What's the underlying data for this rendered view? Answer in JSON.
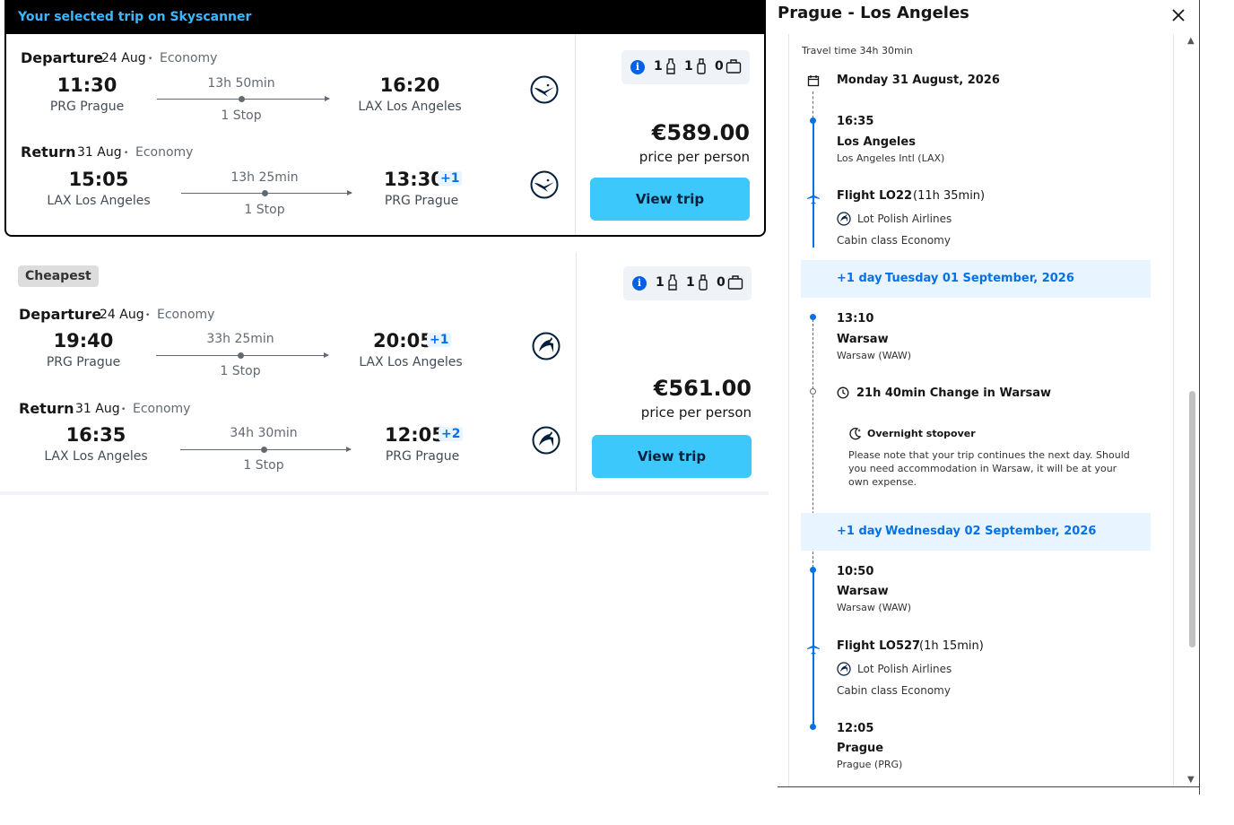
{
  "selected_trip": {
    "header": "Your selected trip on Skyscanner",
    "departure": {
      "title": "Departure",
      "date": "24 Aug",
      "dot": "•",
      "cabin": "Economy",
      "dep_time": "11:30",
      "dep_place": "PRG Prague",
      "duration": "13h 50min",
      "stops": "1 Stop",
      "arr_time": "16:20",
      "arr_place": "LAX Los Angeles",
      "plus_day": ""
    },
    "return": {
      "title": "Return",
      "date": "31 Aug",
      "dot": "•",
      "cabin": "Economy",
      "dep_time": "15:05",
      "dep_place": "LAX Los Angeles",
      "duration": "13h 25min",
      "stops": "1 Stop",
      "arr_time": "13:30",
      "arr_place": "PRG Prague",
      "plus_day": "+1"
    },
    "airline_logo": "lufthansa-crane-icon",
    "bags": {
      "personal": "1",
      "cabin": "1",
      "checked": "0"
    },
    "price": "€589.00",
    "price_sub": "price per person",
    "button": "View trip"
  },
  "cheapest_trip": {
    "badge": "Cheapest",
    "departure": {
      "title": "Departure",
      "date": "24 Aug",
      "dot": "•",
      "cabin": "Economy",
      "dep_time": "19:40",
      "dep_place": "PRG Prague",
      "duration": "33h 25min",
      "stops": "1 Stop",
      "arr_time": "20:05",
      "arr_place": "LAX Los Angeles",
      "plus_day": "+1"
    },
    "return": {
      "title": "Return",
      "date": "31 Aug",
      "dot": "•",
      "cabin": "Economy",
      "dep_time": "16:35",
      "dep_place": "LAX Los Angeles",
      "duration": "34h 30min",
      "stops": "1 Stop",
      "arr_time": "12:05",
      "arr_place": "PRG Prague",
      "plus_day": "+2"
    },
    "airline_logo": "lot-crane-icon",
    "bags": {
      "personal": "1",
      "cabin": "1",
      "checked": "0"
    },
    "price": "€561.00",
    "price_sub": "price per person",
    "button": "View trip"
  },
  "panel": {
    "title": "Prague - Los Angeles",
    "travel_time": "Travel time 34h 30min",
    "date_header": "Monday 31 August, 2026",
    "seg1_time": "16:35",
    "seg1_city": "Los Angeles",
    "seg1_airport": "Los Angeles Intl (LAX)",
    "flight1": "Flight LO22",
    "flight1_duration": "(11h 35min)",
    "flight1_airline": "Lot Polish Airlines",
    "flight1_cabin": "Cabin class Economy",
    "day1_plus": "+1 day",
    "day1_date": "Tuesday 01 September, 2026",
    "seg2_time": "13:10",
    "seg2_city": "Warsaw",
    "seg2_airport": "Warsaw (WAW)",
    "change": "21h 40min Change in Warsaw",
    "stopover_title": "Overnight stopover",
    "stopover_note": "Please note that your trip continues the next day. Should you need accommodation in Warsaw, it will be at your own expense.",
    "day2_plus": "+1 day",
    "day2_date": "Wednesday 02 September, 2026",
    "seg3_time": "10:50",
    "seg3_city": "Warsaw",
    "seg3_airport": "Warsaw (WAW)",
    "flight2": "Flight LO527",
    "flight2_duration": "(1h 15min)",
    "flight2_airline": "Lot Polish Airlines",
    "flight2_cabin": "Cabin class Economy",
    "seg4_time": "12:05",
    "seg4_city": "Prague",
    "seg4_airport": "Prague (PRG)"
  },
  "colors": {
    "accent": "#3ab8ff",
    "button": "#3cc8fb",
    "timeline": "#0770e3",
    "day_band": "#e8f4ff"
  }
}
